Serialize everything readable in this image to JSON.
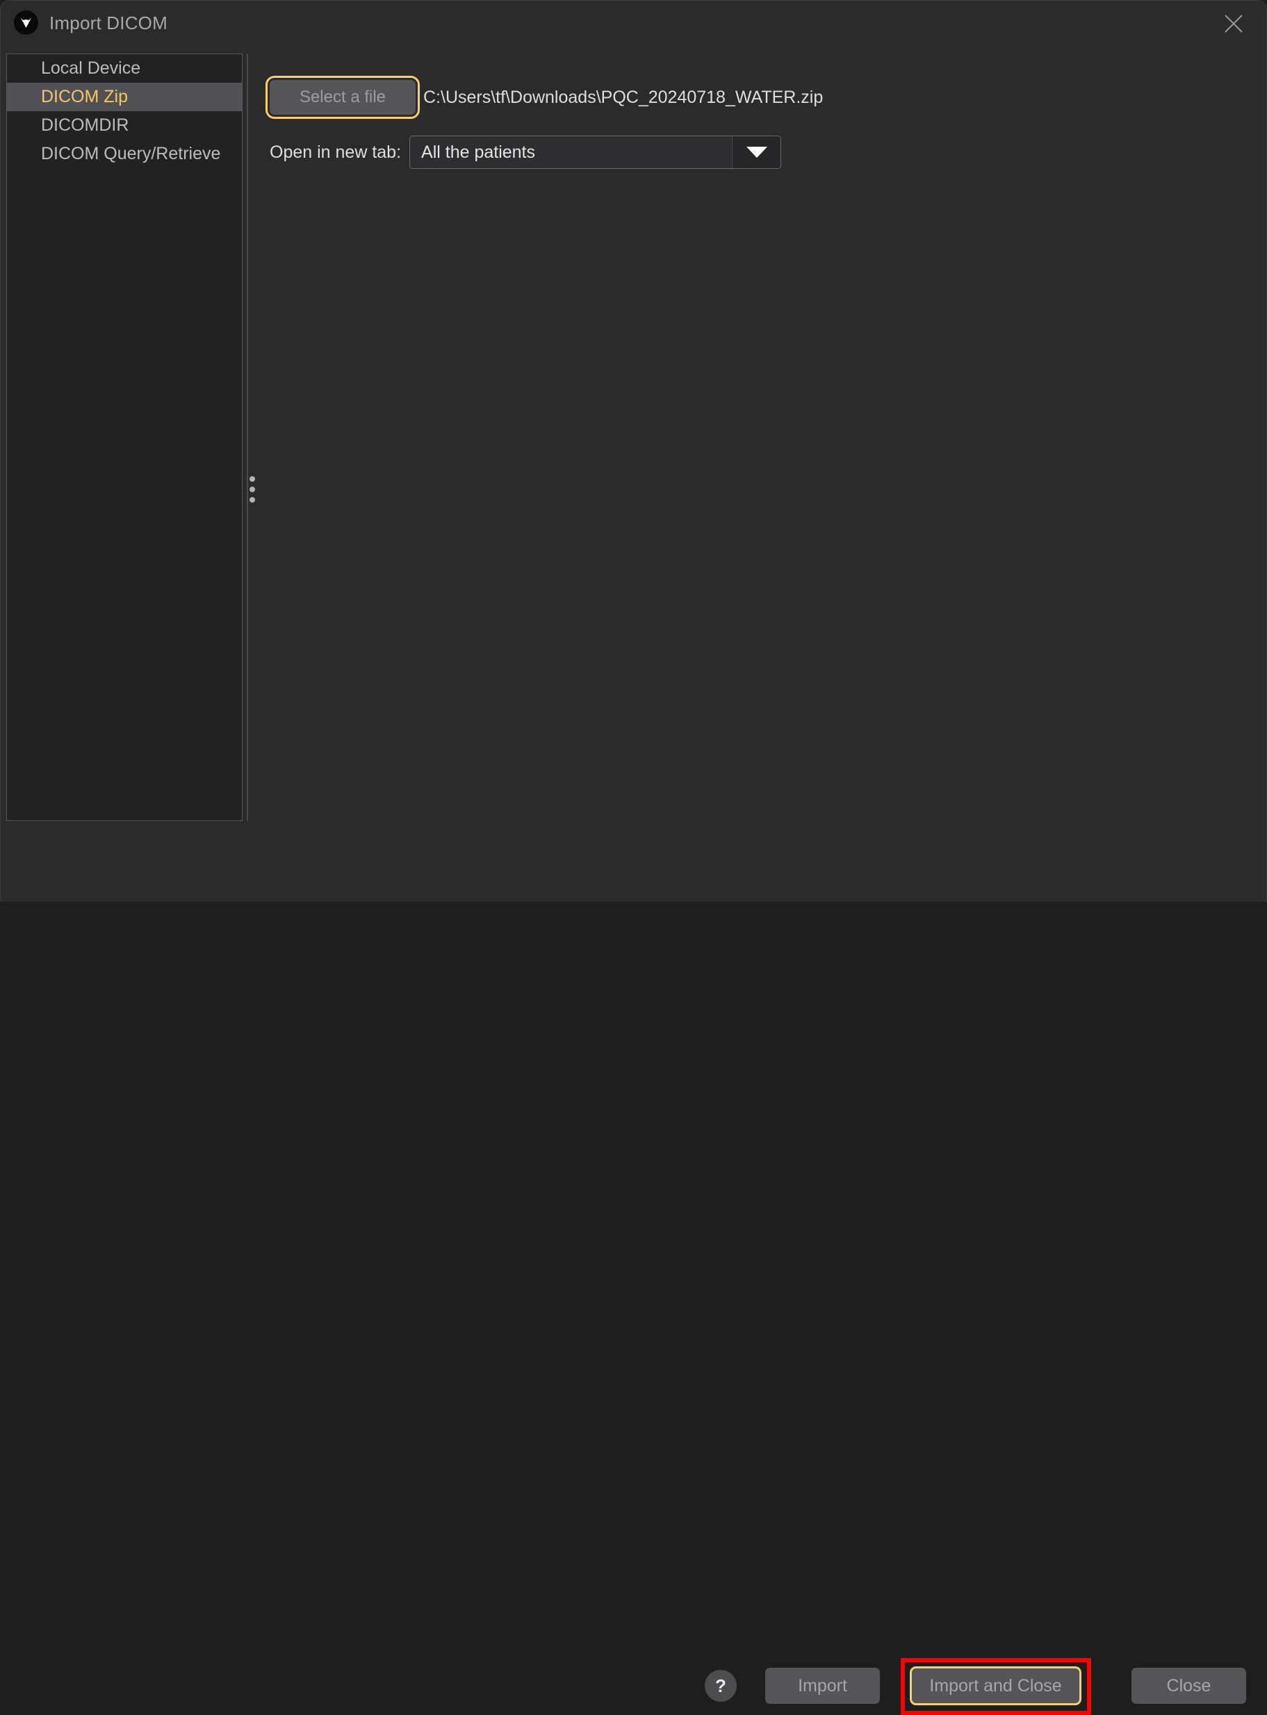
{
  "window": {
    "title": "Import DICOM",
    "logo_icon": "weasis-v-logo-icon",
    "close_icon": "close-icon"
  },
  "sidebar": {
    "items": [
      {
        "label": "Local Device",
        "selected": false
      },
      {
        "label": "DICOM Zip",
        "selected": true
      },
      {
        "label": "DICOMDIR",
        "selected": false
      },
      {
        "label": "DICOM Query/Retrieve",
        "selected": false
      }
    ]
  },
  "splitter": {
    "icon": "splitter-dots-icon"
  },
  "main": {
    "select_file_button": "Select a file",
    "file_path": "C:\\Users\\tf\\Downloads\\PQC_20240718_WATER.zip",
    "open_tab_label": "Open in new tab:",
    "open_tab_value": "All the patients",
    "open_tab_options": [
      "All the patients"
    ],
    "dropdown_icon": "chevron-down-icon"
  },
  "footer": {
    "help_label": "?",
    "help_icon": "help-icon",
    "import_label": "Import",
    "import_and_close_label": "Import and Close",
    "close_label": "Close"
  },
  "colors": {
    "accent": "#f5c862",
    "focus_ring": "#f7cf6b",
    "annotation": "#ff0000",
    "dialog_bg": "#2b2b2c",
    "sidebar_bg": "#222223",
    "selected_row_bg": "#515155",
    "text": "#dedee1"
  }
}
